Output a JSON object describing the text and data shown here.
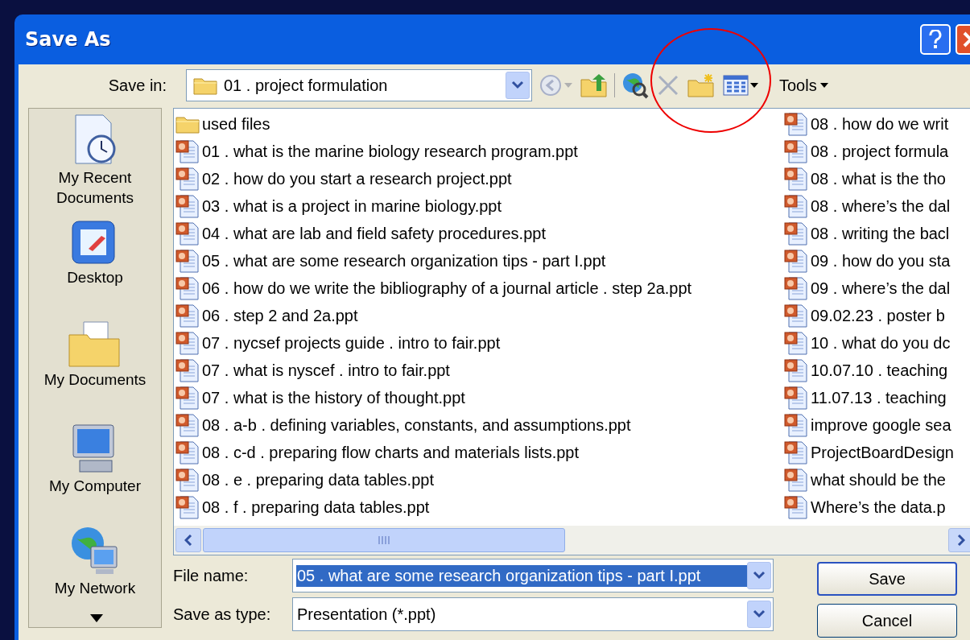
{
  "window": {
    "title": "Save As"
  },
  "toolbar": {
    "save_in_label": "Save in:",
    "location": "01 . project formulation",
    "tools_label": "Tools"
  },
  "places": [
    {
      "label": "My Recent Documents",
      "kind": "recent"
    },
    {
      "label": "Desktop",
      "kind": "desktop"
    },
    {
      "label": "My Documents",
      "kind": "documents"
    },
    {
      "label": "My Computer",
      "kind": "computer"
    },
    {
      "label": "My Network",
      "kind": "network"
    }
  ],
  "files": {
    "columns": [
      [
        {
          "name": "used files",
          "kind": "folder"
        },
        {
          "name": "01 . what is the marine biology research program.ppt",
          "kind": "ppt"
        },
        {
          "name": "02 . how do you start a research project.ppt",
          "kind": "ppt"
        },
        {
          "name": "03 . what is a project in marine biology.ppt",
          "kind": "ppt"
        },
        {
          "name": "04 . what are lab and field safety procedures.ppt",
          "kind": "ppt"
        },
        {
          "name": "05 . what are some research organization tips - part I.ppt",
          "kind": "ppt"
        },
        {
          "name": "06 . how do we write the bibliography of a journal article . step 2a.ppt",
          "kind": "ppt"
        },
        {
          "name": "06 . step 2 and 2a.ppt",
          "kind": "ppt"
        },
        {
          "name": "07 . nycsef projects guide . intro to fair.ppt",
          "kind": "ppt"
        },
        {
          "name": "07 . what is nyscef . intro to fair.ppt",
          "kind": "ppt"
        },
        {
          "name": "07 . what is the history of thought.ppt",
          "kind": "ppt"
        },
        {
          "name": "08 . a-b . defining variables, constants, and assumptions.ppt",
          "kind": "ppt"
        },
        {
          "name": "08 . c-d . preparing flow charts and materials lists.ppt",
          "kind": "ppt"
        },
        {
          "name": "08 . e . preparing data tables.ppt",
          "kind": "ppt"
        },
        {
          "name": "08 . f . preparing data tables.ppt",
          "kind": "ppt"
        }
      ],
      [
        {
          "name": "08 . how do we writ",
          "kind": "ppt"
        },
        {
          "name": "08 . project formula",
          "kind": "ppt"
        },
        {
          "name": "08 . what is the tho",
          "kind": "ppt"
        },
        {
          "name": "08 . where’s the dal",
          "kind": "ppt"
        },
        {
          "name": "08 . writing the bacl",
          "kind": "ppt"
        },
        {
          "name": "09 . how do you sta",
          "kind": "ppt"
        },
        {
          "name": "09 . where’s the dal",
          "kind": "ppt"
        },
        {
          "name": "09.02.23 . poster b",
          "kind": "ppt"
        },
        {
          "name": "10 . what do you dc",
          "kind": "ppt"
        },
        {
          "name": "10.07.10 . teaching",
          "kind": "ppt"
        },
        {
          "name": "11.07.13 . teaching",
          "kind": "ppt"
        },
        {
          "name": "improve google sea",
          "kind": "ppt"
        },
        {
          "name": "ProjectBoardDesign",
          "kind": "ppt"
        },
        {
          "name": "what should be the",
          "kind": "ppt"
        },
        {
          "name": "Where’s the data.p",
          "kind": "ppt"
        }
      ]
    ]
  },
  "file_name": {
    "label": "File name:",
    "value": "05 . what are some research organization tips - part I.ppt",
    "value_selected": true
  },
  "save_as_type": {
    "label": "Save as type:",
    "value": "Presentation (*.ppt)"
  },
  "buttons": [
    "Save",
    "Cancel"
  ]
}
